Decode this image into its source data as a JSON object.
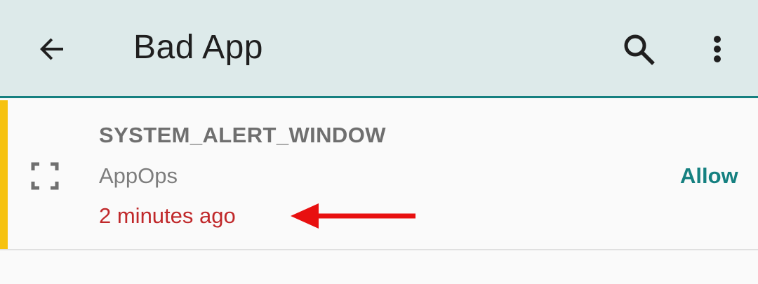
{
  "toolbar": {
    "title": "Bad App",
    "back_icon": "arrow-back-icon",
    "search_icon": "search-icon",
    "more_icon": "more-vert-icon"
  },
  "item": {
    "permission": "SYSTEM_ALERT_WINDOW",
    "source": "AppOps",
    "time": "2 minutes ago",
    "action_label": "Allow",
    "icon": "fullscreen-icon"
  },
  "colors": {
    "toolbar_bg": "#ddeaea",
    "accent": "#158080",
    "status_bar": "#f6c20f",
    "time_text": "#c0282a",
    "annotation_arrow": "#e81010"
  }
}
